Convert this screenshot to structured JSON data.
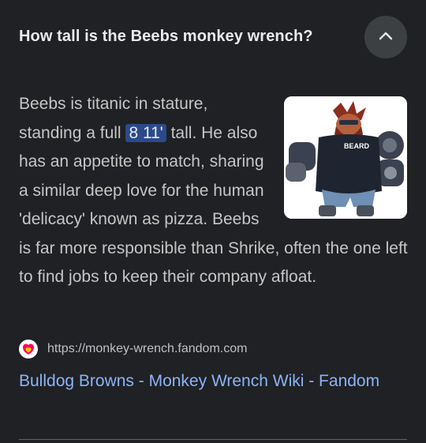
{
  "question": "How tall is the Beebs monkey wrench?",
  "answer": {
    "before": "Beebs is titanic in stature, standing a full ",
    "highlight": "8 11'",
    "after": " tall. He also has an appetite to match, sharing a similar deep love for the human 'delicacy' known as pizza. Beebs is far more responsible than Shrike, often the one left to find jobs to keep their company afloat."
  },
  "thumbnail": {
    "shirt_text": "BEARD"
  },
  "source": {
    "url": "https://monkey-wrench.fandom.com",
    "favicon": "fandom-icon"
  },
  "result_title": "Bulldog Browns - Monkey Wrench Wiki - Fandom",
  "icons": {
    "collapse": "chevron-up-icon"
  },
  "colors": {
    "background": "#202124",
    "link": "#8ab4f8",
    "highlight": "#2b4a8b",
    "button": "#3c4043"
  }
}
